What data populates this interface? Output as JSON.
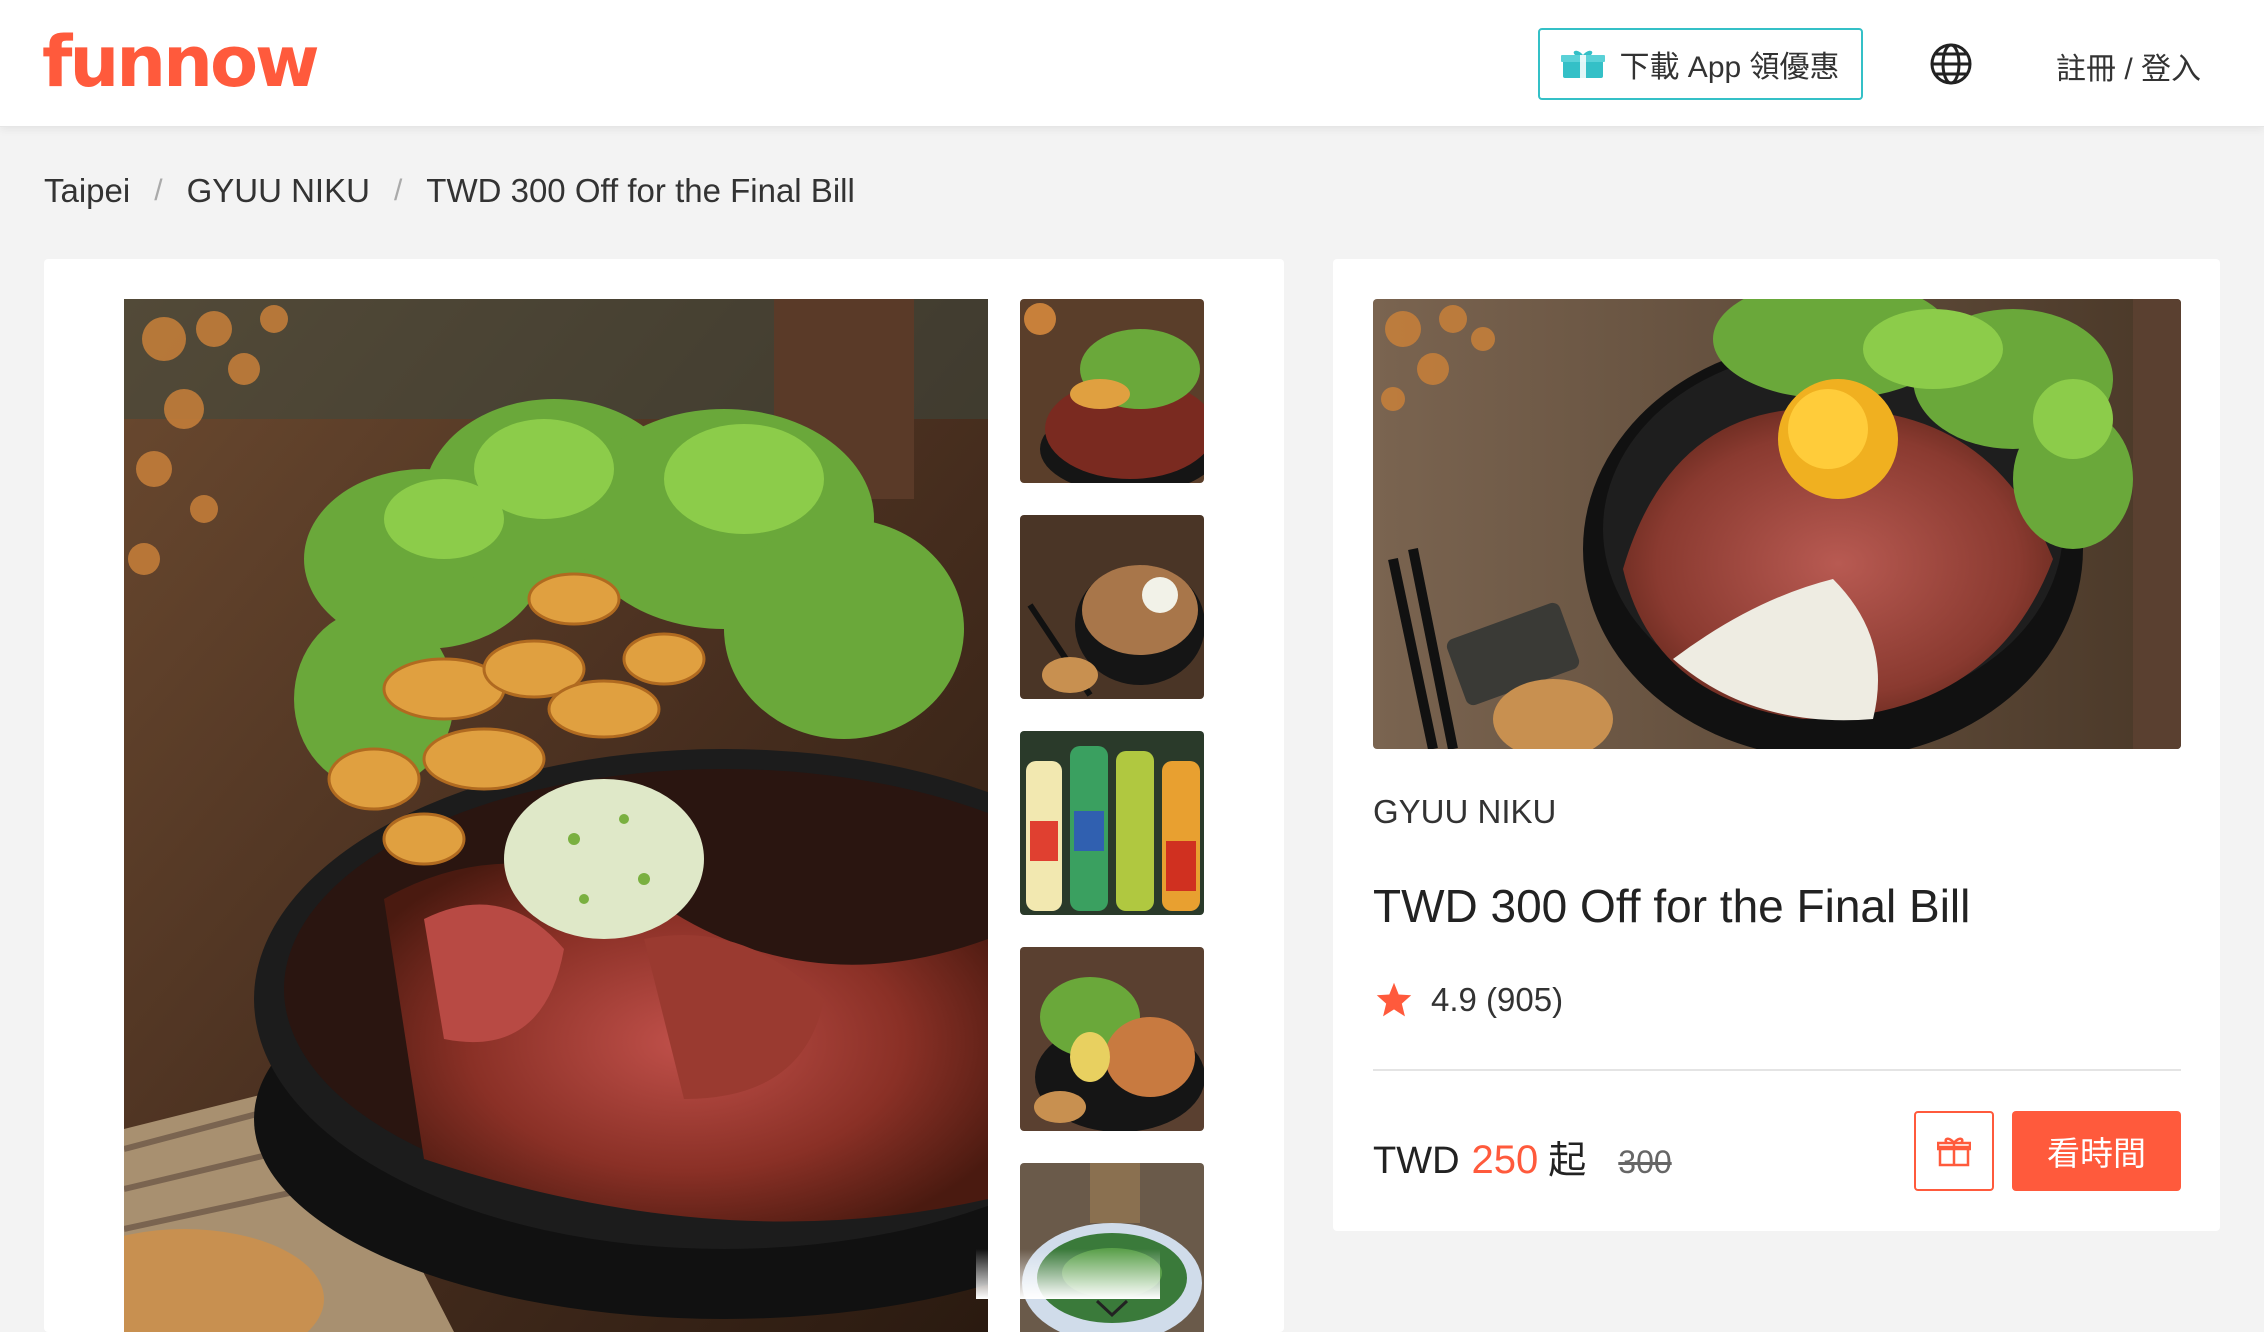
{
  "header": {
    "logo": "funnow",
    "download_label": "下載 App 領優惠",
    "auth_label": "註冊 / 登入"
  },
  "breadcrumb": [
    "Taipei",
    "GYUU NIKU",
    "TWD 300 Off for the Final Bill"
  ],
  "product": {
    "venue": "GYUU NIKU",
    "title": "TWD 300 Off for the Final Bill",
    "rating": "4.9",
    "reviews": "(905)",
    "currency": "TWD",
    "price": "250",
    "price_suffix": "起",
    "original_price": "300",
    "cta_label": "看時間"
  },
  "icons": {
    "gift": "gift-icon",
    "globe": "globe-icon",
    "star": "star-icon",
    "chevron": "chevron-down-icon"
  },
  "colors": {
    "brand": "#ff5a3c",
    "download_border": "#34c0c7",
    "star": "#ff5a3c"
  }
}
